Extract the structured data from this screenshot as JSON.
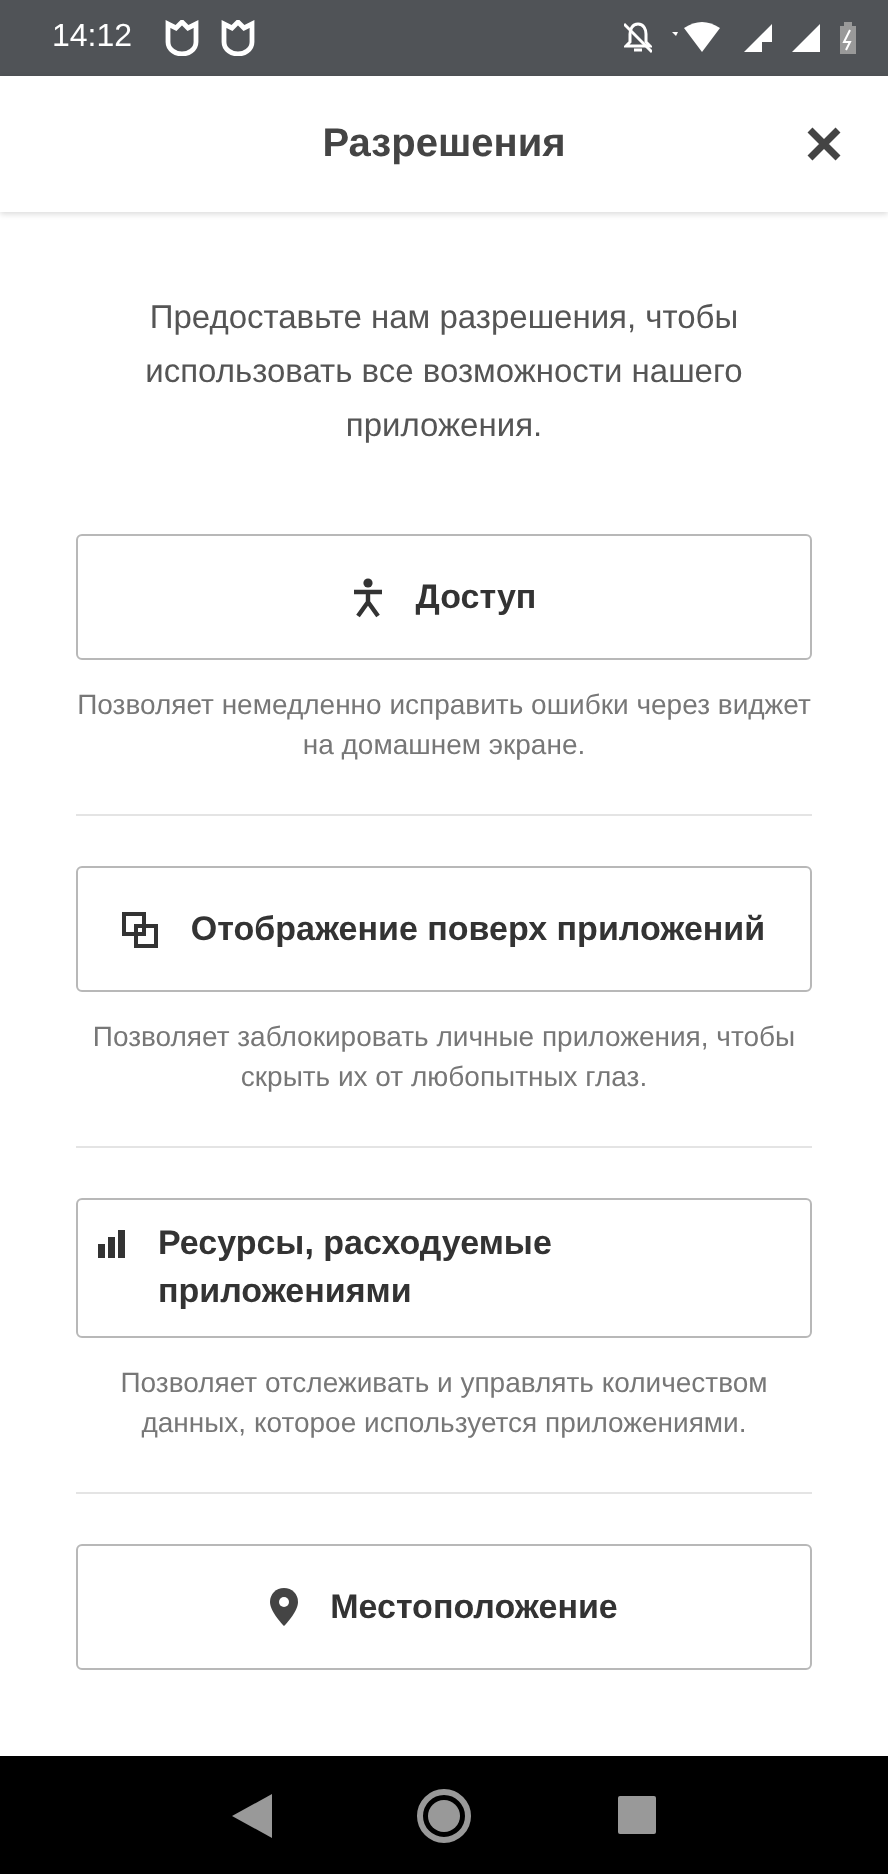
{
  "status_bar": {
    "time": "14:12"
  },
  "header": {
    "title": "Разрешения"
  },
  "intro": "Предоставьте нам разрешения, чтобы использовать все возможности нашего приложения.",
  "permissions": [
    {
      "kind": "accessibility",
      "label": "Доступ",
      "description": "Позволяет немедленно исправить ошибки через виджет на домашнем экране."
    },
    {
      "kind": "overlay",
      "label": "Отображение поверх приложений",
      "description": "Позволяет заблокировать личные приложения, чтобы скрыть их от любопытных глаз."
    },
    {
      "kind": "usage",
      "label": "Ресурсы, расходуемые приложениями",
      "description": "Позволяет отслеживать и управлять количеством данных, которое используется приложениями."
    },
    {
      "kind": "location",
      "label": "Местоположение"
    }
  ]
}
